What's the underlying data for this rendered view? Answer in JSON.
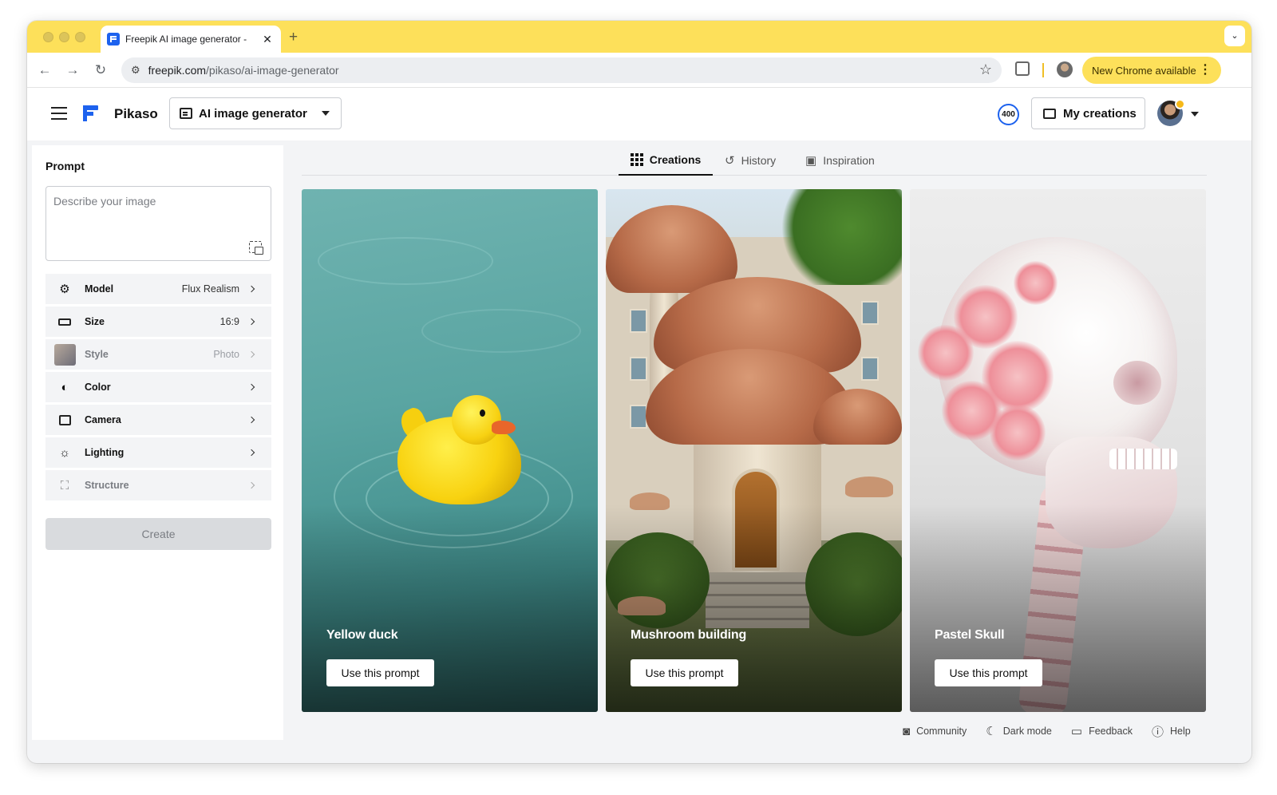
{
  "browser": {
    "tab_title": "Freepik AI image generator - ",
    "tab_close": "✕",
    "new_tab": "+",
    "url_domain": "freepik.com",
    "url_path": "/pikaso/ai-image-generator",
    "update_label": "New Chrome available",
    "accent_color": "#fde05a"
  },
  "header": {
    "brand": "Pikaso",
    "tool_select": "AI image generator",
    "credits": "400",
    "my_creations": "My creations",
    "brand_color": "#1d62ee"
  },
  "prompt": {
    "label": "Prompt",
    "placeholder": "Describe your image"
  },
  "options": [
    {
      "label": "Model",
      "value": "Flux Realism",
      "icon": "chip-icon",
      "disabled": false
    },
    {
      "label": "Size",
      "value": "16:9",
      "icon": "aspect-ratio-icon",
      "disabled": false
    },
    {
      "label": "Style",
      "value": "Photo",
      "icon": "style-thumbnail",
      "disabled": true
    },
    {
      "label": "Color",
      "value": "",
      "icon": "palette-icon",
      "disabled": false
    },
    {
      "label": "Camera",
      "value": "",
      "icon": "camera-icon",
      "disabled": false
    },
    {
      "label": "Lighting",
      "value": "",
      "icon": "sun-icon",
      "disabled": false
    },
    {
      "label": "Structure",
      "value": "",
      "icon": "structure-icon",
      "disabled": true
    }
  ],
  "create_button": "Create",
  "tabs": [
    {
      "label": "Creations",
      "icon": "grid-icon",
      "active": true
    },
    {
      "label": "History",
      "icon": "history-icon",
      "active": false
    },
    {
      "label": "Inspiration",
      "icon": "inspiration-icon",
      "active": false
    }
  ],
  "cards": [
    {
      "title": "Yellow duck",
      "button": "Use this prompt"
    },
    {
      "title": "Mushroom building",
      "button": "Use this prompt"
    },
    {
      "title": "Pastel Skull",
      "button": "Use this prompt"
    }
  ],
  "footer": [
    {
      "label": "Community",
      "icon": "discord-icon"
    },
    {
      "label": "Dark mode",
      "icon": "moon-icon"
    },
    {
      "label": "Feedback",
      "icon": "feedback-icon"
    },
    {
      "label": "Help",
      "icon": "help-icon"
    }
  ]
}
